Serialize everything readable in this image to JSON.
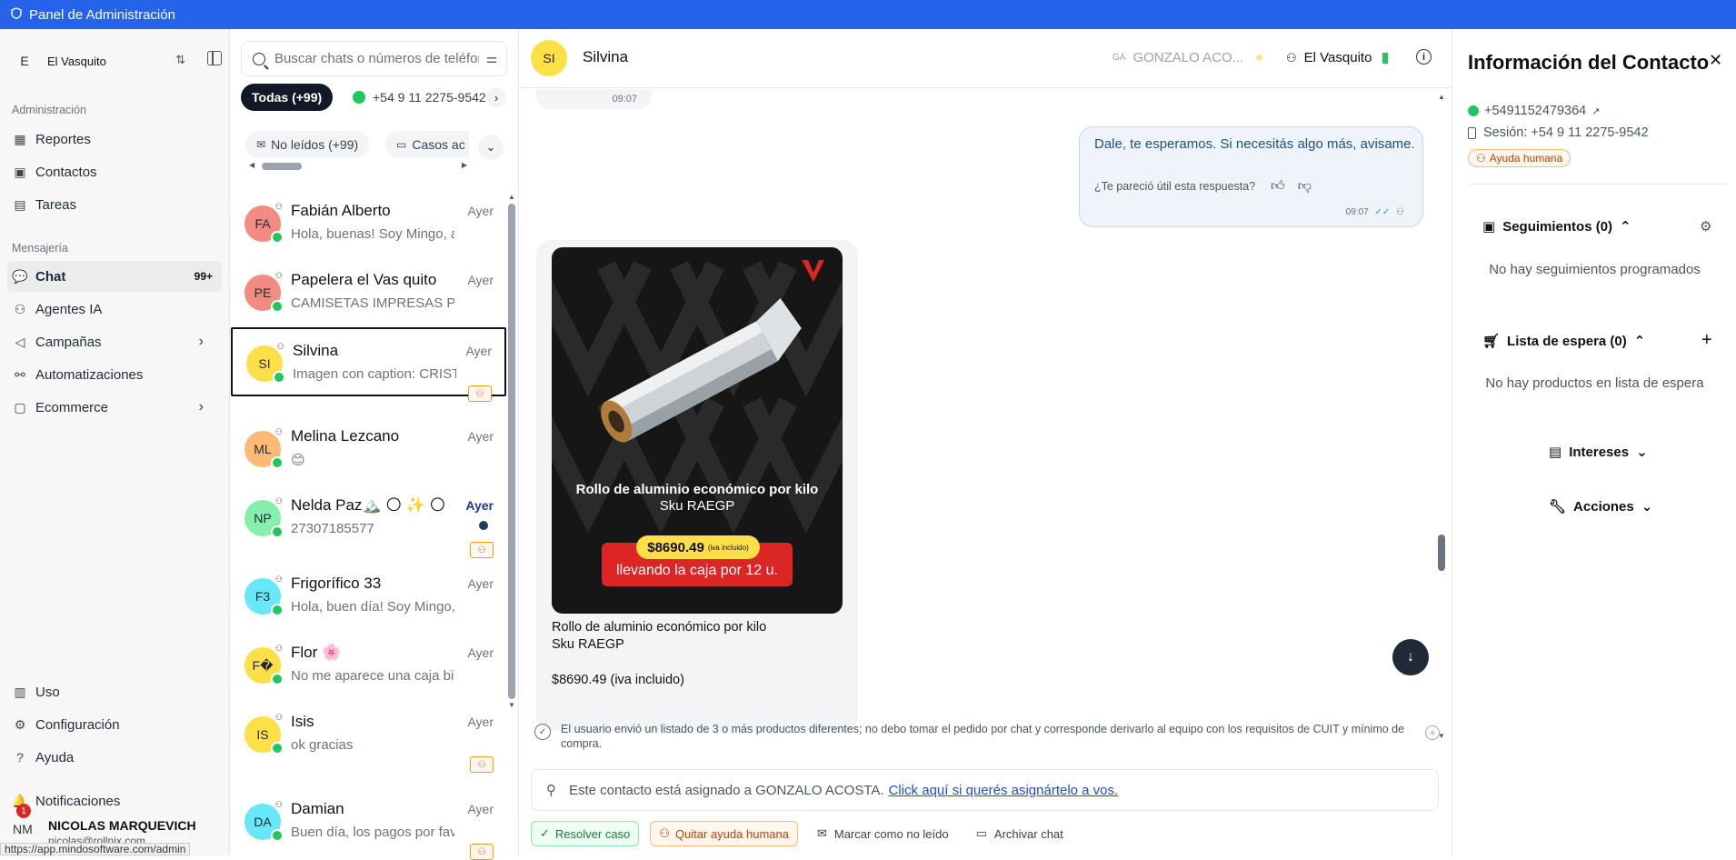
{
  "topbar": {
    "title": "Panel de Administración"
  },
  "sidebar": {
    "workspace_letter": "E",
    "workspace_name": "El Vasquito",
    "section_admin": "Administración",
    "section_messaging": "Mensajería",
    "items_admin": [
      {
        "label": "Reportes",
        "icon": "chart-icon"
      },
      {
        "label": "Contactos",
        "icon": "contact-book-icon"
      },
      {
        "label": "Tareas",
        "icon": "clipboard-icon"
      }
    ],
    "items_messaging": [
      {
        "label": "Chat",
        "icon": "chat-icon",
        "badge": "99+"
      },
      {
        "label": "Agentes IA",
        "icon": "bot-icon"
      },
      {
        "label": "Campañas",
        "icon": "megaphone-icon"
      },
      {
        "label": "Automatizaciones",
        "icon": "workflow-icon"
      },
      {
        "label": "Ecommerce",
        "icon": "store-icon"
      }
    ],
    "items_bottom": [
      {
        "label": "Uso",
        "icon": "bar-chart-icon"
      },
      {
        "label": "Configuración",
        "icon": "gear-icon"
      },
      {
        "label": "Ayuda",
        "icon": "help-icon"
      },
      {
        "label": "Notificaciones",
        "icon": "bell-icon",
        "count": "1"
      }
    ],
    "user": {
      "initials": "NM",
      "name": "NICOLAS MARQUEVICH",
      "email": "nicolas@rollnix.com"
    },
    "status_url": "https://app.mindosoftware.com/admin"
  },
  "chatlist": {
    "search_placeholder": "Buscar chats o números de teléfono",
    "filter_all": "Todas (+99)",
    "filter_phone": "+54 9 11 2275-9542",
    "filter_unread": "No leídos (+99)",
    "filter_cases": "Casos ac",
    "chats": [
      {
        "initials": "FA",
        "avatar_color": "#f28b82",
        "name": "Fabián Alberto",
        "preview": "Hola, buenas! Soy Mingo, asistente",
        "time": "Ayer"
      },
      {
        "initials": "PE",
        "avatar_color": "#f28b82",
        "name": "Papelera el Vas quito",
        "preview": "CAMISETAS IMPRESAS PARA",
        "time": "Ayer"
      },
      {
        "initials": "SI",
        "avatar_color": "#fde047",
        "name": "Silvina",
        "preview": "Imagen con caption: CRISTAL",
        "time": "Ayer"
      },
      {
        "initials": "ML",
        "avatar_color": "#fdba74",
        "name": "Melina Lezcano",
        "preview": "😊",
        "time": "Ayer"
      },
      {
        "initials": "NP",
        "avatar_color": "#86efac",
        "name": "Nelda Paz🏔️ 🌕 ✨ 🌕",
        "preview": "27307185577",
        "time": "Ayer"
      },
      {
        "initials": "F3",
        "avatar_color": "#67e8f9",
        "name": "Frigorífico 33",
        "preview": "Hola, buen día! Soy Mingo, asistente",
        "time": "Ayer"
      },
      {
        "initials": "F�",
        "avatar_color": "#fde047",
        "name": "Flor 🌸",
        "preview": "No me aparece una caja bien",
        "time": "Ayer"
      },
      {
        "initials": "IS",
        "avatar_color": "#fde047",
        "name": "Isis",
        "preview": "ok gracias",
        "time": "Ayer"
      },
      {
        "initials": "DA",
        "avatar_color": "#67e8f9",
        "name": "Damian",
        "preview": "Buen día, los pagos por favor",
        "time": "Ayer"
      }
    ]
  },
  "conversation": {
    "contact_initials": "SI",
    "contact_name": "Silvina",
    "agent_initials": "GA",
    "agent_name": "GONZALO ACO...",
    "workspace": "El Vasquito",
    "stub_time": "09:07",
    "out_message": "Dale, te esperamos. Si necesitás algo más, avisame.",
    "feedback_question": "¿Te pareció útil esta respuesta?",
    "out_time": "09:07",
    "product_image": {
      "title": "Rollo de aluminio económico por kilo",
      "sku": "Sku RAEGP",
      "price": "$8690.49",
      "price_note": "(iva incluido)",
      "banner": "llevando la caja por 12 u.",
      "logo_letter": "V"
    },
    "caption_line1": "Rollo de aluminio económico por kilo",
    "caption_line2": "Sku RAEGP",
    "caption_line3": "$8690.49 (iva incluido)",
    "system_note": "El usuario envió un listado de 3 o más productos diferentes; no debo tomar el pedido por chat y corresponde derivarlo al equipo con los requisitos de CUIT y mínimo de compra.",
    "assign_text": "Este contacto está asignado a GONZALO ACOSTA.",
    "assign_link": "Click aquí si querés asignártelo a vos.",
    "actions": {
      "resolve": "Resolver caso",
      "remove_help": "Quitar ayuda humana",
      "mark_unread": "Marcar como no leído",
      "archive": "Archivar chat"
    }
  },
  "contact_info": {
    "title": "Información del Contacto",
    "phone": "+5491152479364",
    "session": "Sesión: +54 9 11 2275-9542",
    "help_tag": "Ayuda humana",
    "followups_title": "Seguimientos (0)",
    "followups_empty": "No hay seguimientos programados",
    "waitlist_title": "Lista de espera (0)",
    "waitlist_empty": "No hay productos en lista de espera",
    "interests_title": "Intereses",
    "actions_title": "Acciones"
  }
}
